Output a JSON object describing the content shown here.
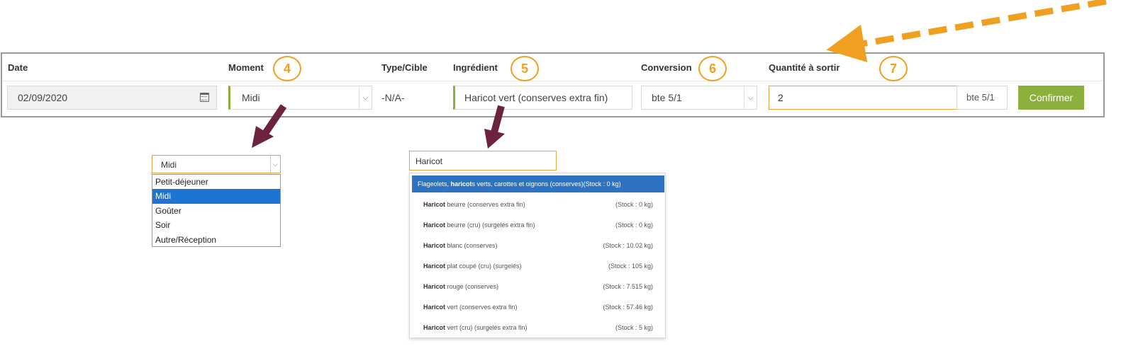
{
  "form": {
    "labels": {
      "date": "Date",
      "moment": "Moment",
      "type": "Type/Cible",
      "ingredient": "Ingrédient",
      "conversion": "Conversion",
      "quantity": "Quantité à sortir"
    },
    "date_value": "02/09/2020",
    "moment_value": "Midi",
    "type_value": "-N/A-",
    "ingredient_value": "Haricot vert (conserves extra fin)",
    "conversion_value": "bte 5/1",
    "quantity_value": "2",
    "unit": "bte 5/1",
    "confirm_label": "Confirmer"
  },
  "badges": [
    "4",
    "5",
    "6",
    "7"
  ],
  "moment_dropdown": {
    "selected": "Midi",
    "options": [
      "Petit-déjeuner",
      "Midi",
      "Goûter",
      "Soir",
      "Autre/Réception"
    ],
    "active_index": 1
  },
  "autocomplete": {
    "query": "Haricot",
    "items": [
      {
        "pre": "Flageolets, ",
        "bold": "haricot",
        "rest": "s verts, carottes et oignons (conserves)",
        "stock": "(Stock : 0 kg)"
      },
      {
        "pre": "",
        "bold": "Haricot",
        "rest": " beurre (conserves extra fin)",
        "stock": "(Stock : 0 kg)"
      },
      {
        "pre": "",
        "bold": "Haricot",
        "rest": " beurre (cru) (surgelés extra fin)",
        "stock": "(Stock : 0 kg)"
      },
      {
        "pre": "",
        "bold": "Haricot",
        "rest": " blanc (conserves)",
        "stock": "(Stock : 10.02 kg)"
      },
      {
        "pre": "",
        "bold": "Haricot",
        "rest": " plat coupé (cru) (surgelés)",
        "stock": "(Stock : 105 kg)"
      },
      {
        "pre": "",
        "bold": "Haricot",
        "rest": " rouge (conserves)",
        "stock": "(Stock : 7.515 kg)"
      },
      {
        "pre": "",
        "bold": "Haricot",
        "rest": " vert (conserves extra fin)",
        "stock": "(Stock : 57.46 kg)"
      },
      {
        "pre": "",
        "bold": "Haricot",
        "rest": " vert (cru) (surgelés extra fin)",
        "stock": "(Stock : 5 kg)"
      }
    ]
  },
  "colors": {
    "accent_green": "#8cb03c",
    "annotation_orange": "#f0a020",
    "arrow_dark": "#6b2340",
    "highlight_blue": "#2e73c1"
  }
}
